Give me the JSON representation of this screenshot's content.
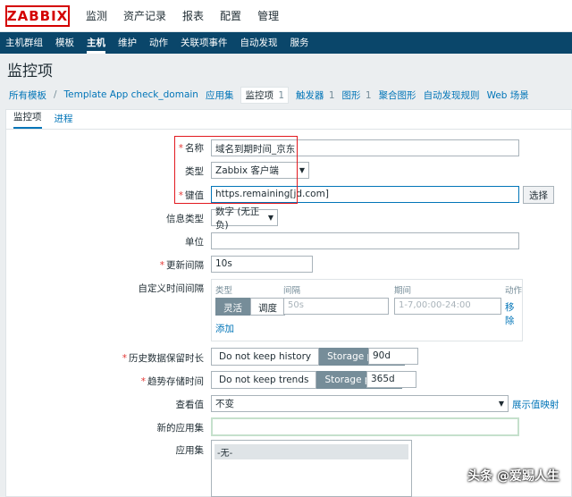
{
  "header": {
    "logo": "ZABBIX",
    "menu": [
      "监测",
      "资产记录",
      "报表",
      "配置",
      "管理"
    ]
  },
  "subnav": [
    "主机群组",
    "模板",
    "主机",
    "维护",
    "动作",
    "关联项事件",
    "自动发现",
    "服务"
  ],
  "page_title": "监控项",
  "breadcrumb": {
    "all_templates": "所有模板",
    "template": "Template App check_domain",
    "items": [
      {
        "label": "应用集",
        "count": ""
      },
      {
        "label": "监控项",
        "count": "1"
      },
      {
        "label": "触发器",
        "count": "1"
      },
      {
        "label": "图形",
        "count": "1"
      },
      {
        "label": "聚合图形",
        "count": ""
      },
      {
        "label": "自动发现规则",
        "count": ""
      },
      {
        "label": "Web 场景",
        "count": ""
      }
    ],
    "sep": "/"
  },
  "tabs": [
    "监控项",
    "进程"
  ],
  "form": {
    "name_label": "名称",
    "name_value": "域名到期时间_京东",
    "type_label": "类型",
    "type_value": "Zabbix 客户端",
    "key_label": "键值",
    "key_value": "https.remaining[jd.com]",
    "select_button": "选择",
    "info_type_label": "信息类型",
    "info_type_value": "数字 (无正负)",
    "units_label": "单位",
    "units_value": "",
    "interval_label": "更新间隔",
    "interval_value": "10s",
    "custom_label": "自定义时间间隔",
    "custom": {
      "col_type": "类型",
      "col_interval": "间隔",
      "col_period": "期间",
      "col_action": "动作",
      "flex": "灵活",
      "schedule": "调度",
      "interval_placeholder": "50s",
      "period_placeholder": "1-7,00:00-24:00",
      "remove": "移除",
      "add": "添加"
    },
    "history_label": "历史数据保留时长",
    "history_no_keep": "Do not keep history",
    "history_storage": "Storage period",
    "history_value": "90d",
    "trends_label": "趋势存储时间",
    "trends_no_keep": "Do not keep trends",
    "trends_storage": "Storage period",
    "trends_value": "365d",
    "showvalue_label": "查看值",
    "showvalue_value": "不变",
    "showvalue_link": "展示值映射",
    "new_app_label": "新的应用集",
    "new_app_value": "",
    "app_label": "应用集",
    "app_option": "-无-"
  },
  "watermark": "头条 @爱踢人生",
  "colors": {
    "nav_bg": "#0a466a",
    "link": "#0275b8",
    "required": "#e33734",
    "annotation": "#e2191f",
    "segment_on": "#768d99"
  }
}
